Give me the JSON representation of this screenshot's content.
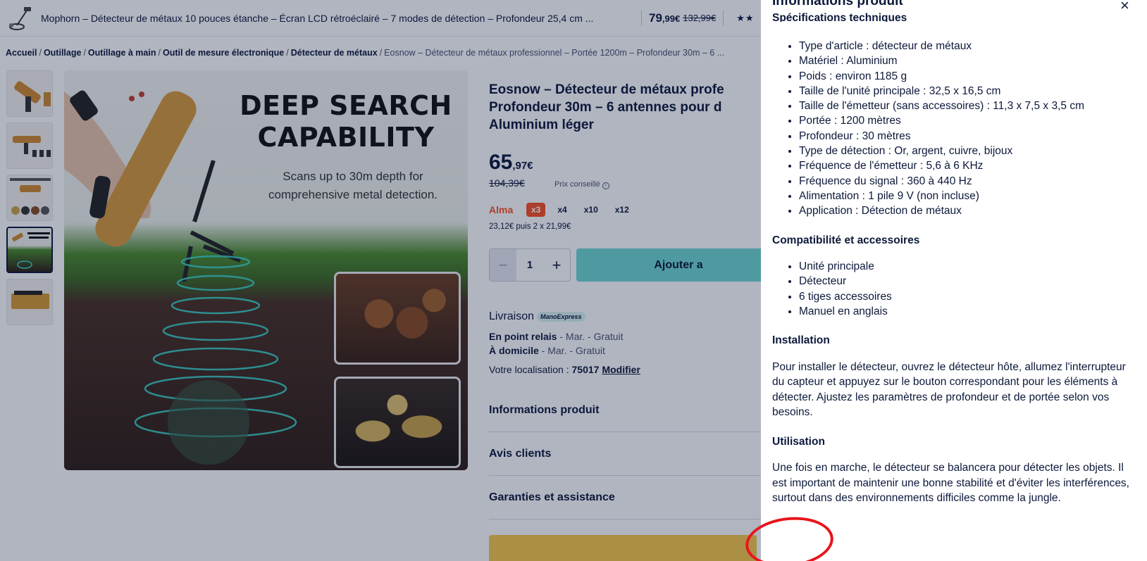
{
  "sticky_bar": {
    "title": "Mophorn – Détecteur de métaux 10 pouces étanche – Écran LCD rétroéclairé – 7 modes de détection – Profondeur 25,4 cm ...",
    "price_main": "79",
    "price_cents": ",99€",
    "old_price": "132,99€",
    "stars": "★★"
  },
  "breadcrumb": {
    "items": [
      "Accueil",
      "Outillage",
      "Outillage à main",
      "Outil de mesure électronique",
      "Détecteur de métaux"
    ],
    "current": "Eosnow – Détecteur de métaux professionnel – Portée 1200m – Profondeur 30m – 6 ..."
  },
  "hero_image": {
    "headline_line1": "DEEP SEARCH",
    "headline_line2": "CAPABILITY",
    "subline1": "Scans up to 30m depth for",
    "subline2": "comprehensive metal detection."
  },
  "product": {
    "title_line1": "Eosnow – Détecteur de métaux profe",
    "title_line2": "Profondeur 30m – 6 antennes pour d",
    "title_line3": "Aluminium léger",
    "price_main": "65",
    "price_cents": ",97€",
    "old_price": "104,39€",
    "reco_label": "Prix conseillé",
    "info_icon": "info-icon"
  },
  "alma": {
    "brand": "Alma",
    "options": [
      "x3",
      "x4",
      "x10",
      "x12"
    ],
    "detail": "23,12€ puis 2 x 21,99€"
  },
  "cart": {
    "qty": "1",
    "minus": "−",
    "plus": "+",
    "add_label": "Ajouter a"
  },
  "delivery": {
    "title": "Livraison",
    "badge": "ManoExpress",
    "relay_label": "En point relais",
    "relay_value": " - Mar. - Gratuit",
    "home_label": "À domicile",
    "home_value": " - Mar. - Gratuit",
    "loc_label": "Votre localisation : ",
    "loc_value": "75017",
    "loc_modify": "Modifier"
  },
  "accordions": [
    "Informations produit",
    "Avis clients",
    "Garanties et assistance"
  ],
  "panel": {
    "title": "Informations produit",
    "close": "×",
    "cut_heading": "Spécifications techniques",
    "specs": [
      "Type d'article : détecteur de métaux",
      "Matériel : Aluminium",
      "Poids : environ 1185 g",
      "Taille de l'unité principale : 32,5 x 16,5 cm",
      "Taille de l'émetteur (sans accessoires) : 11,3 x 7,5 x 3,5 cm",
      "Portée : 1200 mètres",
      "Profondeur : 30 mètres",
      "Type de détection : Or, argent, cuivre, bijoux",
      "Fréquence de l'émetteur : 5,6 à 6 KHz",
      "Fréquence du signal : 360 à 440 Hz",
      "Alimentation : 1 pile 9 V (non incluse)",
      "Application : Détection de métaux"
    ],
    "compat_heading": "Compatibilité et accessoires",
    "compat_items": [
      "Unité principale",
      "Détecteur",
      "6 tiges accessoires",
      "Manuel en anglais"
    ],
    "install_heading": "Installation",
    "install_text": "Pour installer le détecteur, ouvrez le détecteur hôte, allumez l'interrupteur du capteur et appuyez sur le bouton correspondant pour les éléments à détecter. Ajustez les paramètres de profondeur et de portée selon vos besoins.",
    "usage_heading": "Utilisation",
    "usage_text": "Une fois en marche, le détecteur se balancera pour détecter les objets. Il est important de maintenir une bonne stabilité et d'éviter les interférences, surtout dans des environnements difficiles comme la jungle."
  },
  "colors": {
    "overlay": "#0c193a",
    "accent_teal": "#6fd8d1",
    "alma_orange": "#fa5022",
    "annotation_red": "#e8151c"
  }
}
